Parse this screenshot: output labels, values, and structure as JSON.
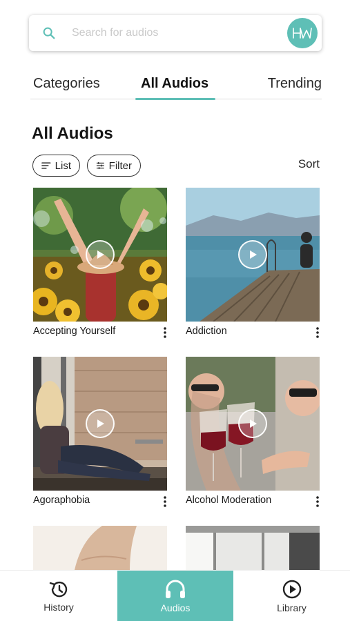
{
  "search": {
    "placeholder": "Search for audios",
    "value": ""
  },
  "logo": {
    "text": "HW"
  },
  "tabs": [
    {
      "label": "Categories",
      "active": false
    },
    {
      "label": "All Audios",
      "active": true
    },
    {
      "label": "Trending",
      "active": false
    }
  ],
  "section": {
    "title": "All Audios"
  },
  "controls": {
    "list_label": "List",
    "filter_label": "Filter",
    "sort_label": "Sort"
  },
  "audios": [
    {
      "title": "Accepting Yourself"
    },
    {
      "title": "Addiction"
    },
    {
      "title": "Agoraphobia"
    },
    {
      "title": "Alcohol Moderation"
    }
  ],
  "bottom_nav": {
    "items": [
      {
        "label": "History",
        "icon": "history-icon",
        "active": false
      },
      {
        "label": "Audios",
        "icon": "headphones-icon",
        "active": true
      },
      {
        "label": "Library",
        "icon": "play-circle-icon",
        "active": false
      }
    ]
  },
  "colors": {
    "accent": "#5ebfb6",
    "text": "#1f1f1f",
    "placeholder": "#c9c9c9"
  }
}
